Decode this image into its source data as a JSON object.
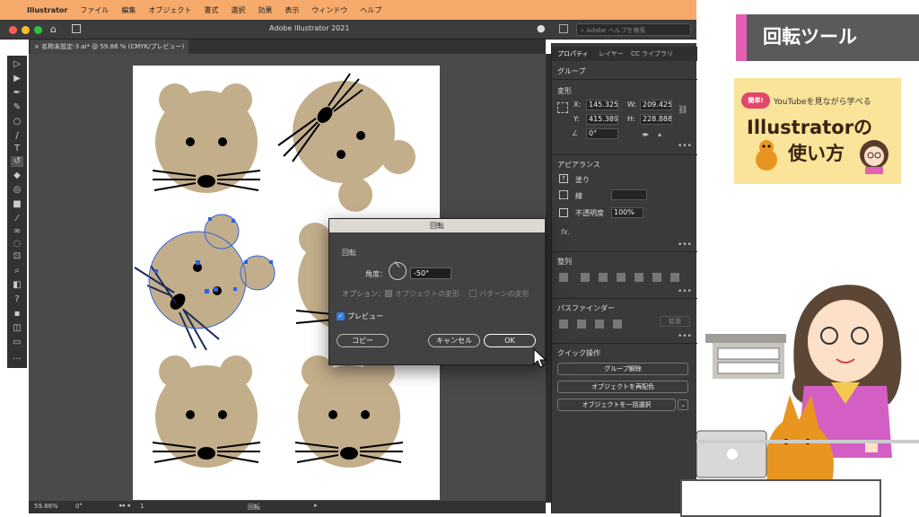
{
  "menubar": {
    "app": "Illustrator",
    "items": [
      "ファイル",
      "編集",
      "オブジェクト",
      "書式",
      "選択",
      "効果",
      "表示",
      "ウィンドウ",
      "ヘルプ"
    ]
  },
  "window": {
    "title": "Adobe Illustrator 2021",
    "search_placeholder": "Adobe ヘルプを検索",
    "doc_tab": "名称未設定-3.ai* @ 59.86 % (CMYK/プレビュー)"
  },
  "status": {
    "zoom": "59.86%",
    "angle": "0°",
    "artboard": "1",
    "tool": "回転"
  },
  "panel": {
    "tabs": [
      "プロパティ",
      "レイヤー",
      "CC ライブラリ"
    ],
    "group_label": "グループ",
    "transform": {
      "title": "変形",
      "x_label": "X:",
      "x": "145.325",
      "y_label": "Y:",
      "y": "415.389",
      "w_label": "W:",
      "w": "209.425",
      "h_label": "H:",
      "h": "228.888",
      "angle": "0°"
    },
    "appearance": {
      "title": "アピアランス",
      "fill": "塗り",
      "stroke": "線",
      "opacity_label": "不透明度",
      "opacity": "100%",
      "fx": "fx."
    },
    "align_title": "整列",
    "pathfinder": {
      "title": "パスファインダー",
      "expand": "拡張"
    },
    "quick_actions": {
      "title": "クイック操作",
      "ungroup": "グループ解除",
      "recolor": "オブジェクトを再配色",
      "select_same": "オブジェクトを一括選択"
    }
  },
  "dialog": {
    "title": "回転",
    "section": "回転",
    "angle_label": "角度：",
    "angle_value": "-50°",
    "options_label": "オプション：",
    "opt_objects": "オブジェクトの変形",
    "opt_patterns": "パターンの変形",
    "preview_label": "プレビュー",
    "preview_checked": true,
    "copy_button": "コピー",
    "cancel_button": "キャンセル",
    "ok_button": "OK"
  },
  "overlay": {
    "heading": "回転ツール",
    "badge": "簡単!",
    "tagline": "YouTubeを見ながら学べる",
    "title_line1": "Illustratorの",
    "title_line2": "使い方"
  },
  "colors": {
    "menubar": "#f6ab6c",
    "bear_fill": "#c2ae8a",
    "accent_pink": "#e35fb1",
    "card_yellow": "#fae49a",
    "selection_blue": "#2f62e0"
  }
}
